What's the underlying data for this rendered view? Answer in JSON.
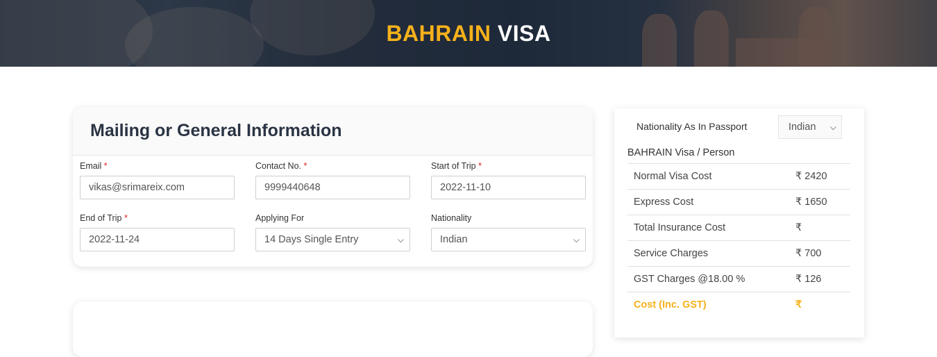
{
  "hero": {
    "title_accent": "BAHRAIN",
    "title_rest": "VISA"
  },
  "mailing": {
    "title": "Mailing or General Information",
    "fields": {
      "email": {
        "label": "Email",
        "required": "*",
        "value": "vikas@srimareix.com"
      },
      "contact": {
        "label": "Contact No.",
        "required": "*",
        "value": "9999440648"
      },
      "start": {
        "label": "Start of Trip",
        "required": "*",
        "value": "2022-11-10"
      },
      "end": {
        "label": "End of Trip",
        "required": "*",
        "value": "2022-11-24"
      },
      "applying": {
        "label": "Applying For",
        "value": "14 Days Single Entry"
      },
      "nationality": {
        "label": "Nationality",
        "value": "Indian"
      }
    }
  },
  "summary": {
    "nationality_label": "Nationality As In Passport",
    "nationality_value": "Indian",
    "per_person": "BAHRAIN Visa / Person",
    "rows": [
      {
        "label": "Normal Visa Cost",
        "value": "₹ 2420"
      },
      {
        "label": "Express Cost",
        "value": "₹ 1650"
      },
      {
        "label": "Total Insurance Cost",
        "value": "₹"
      },
      {
        "label": "Service Charges",
        "value": "₹ 700"
      },
      {
        "label": "GST Charges @18.00 %",
        "value": "₹ 126"
      }
    ],
    "total": {
      "label": "Cost (Inc. GST)",
      "value": "₹"
    }
  },
  "colors": {
    "accent": "#f5b11b",
    "heading": "#2b3444",
    "required": "#e02020"
  },
  "icons": {
    "dropdown": "chevron-down-icon"
  }
}
